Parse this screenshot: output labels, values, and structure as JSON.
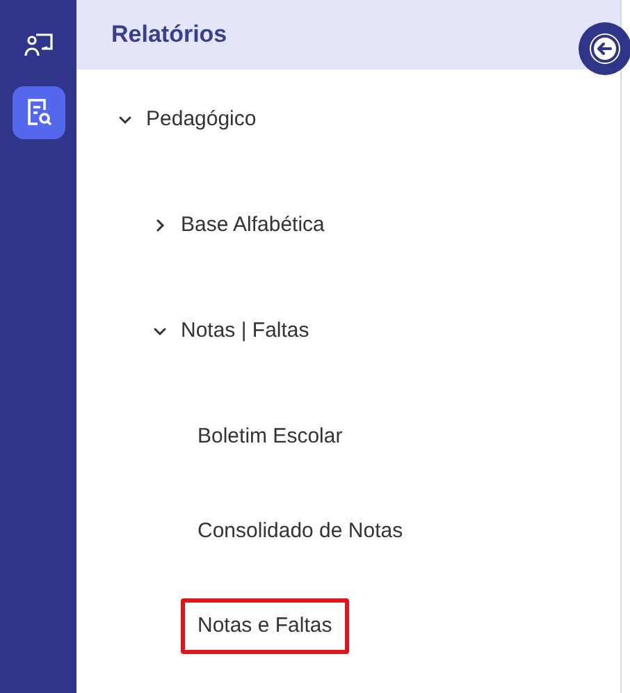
{
  "rail": {
    "items": [
      {
        "kind": "teacher",
        "selected": false
      },
      {
        "kind": "reports",
        "selected": true
      }
    ]
  },
  "panel": {
    "title": "Relatórios",
    "tree": [
      {
        "label": "Pedagógico",
        "kind": "group",
        "expanded": true,
        "children": [
          {
            "label": "Base Alfabética",
            "kind": "group",
            "expanded": false
          },
          {
            "label": "Notas | Faltas",
            "kind": "group",
            "expanded": true,
            "children": [
              {
                "label": "Boletim Escolar",
                "kind": "report",
                "highlighted": false
              },
              {
                "label": "Consolidado de Notas",
                "kind": "report",
                "highlighted": false
              },
              {
                "label": "Notas e Faltas",
                "kind": "report",
                "highlighted": true
              }
            ]
          }
        ]
      }
    ]
  }
}
